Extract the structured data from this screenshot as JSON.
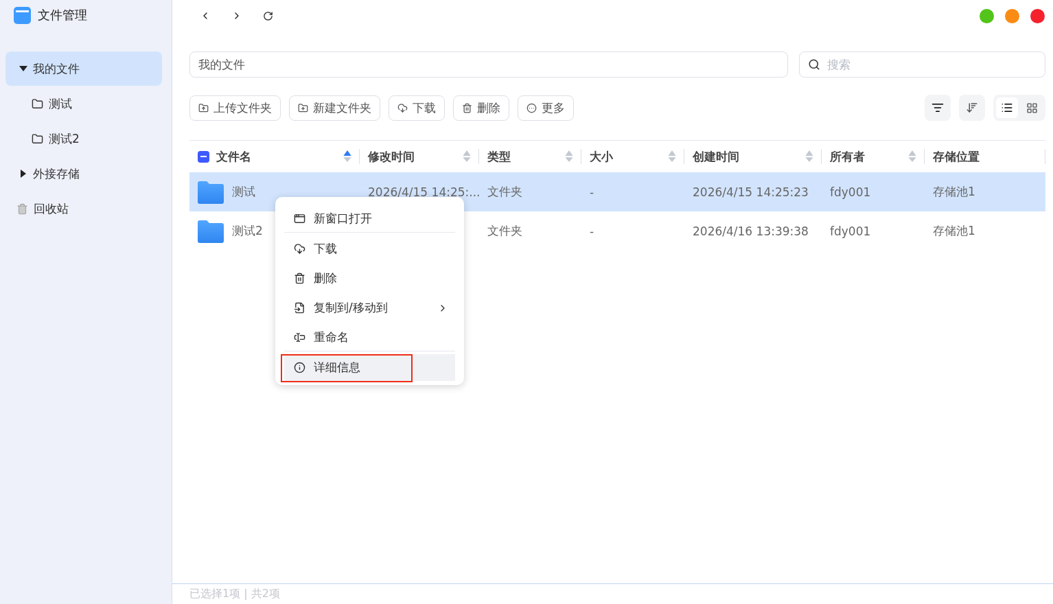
{
  "app": {
    "title": "文件管理"
  },
  "sidebar": {
    "items": [
      {
        "label": "我的文件",
        "kind": "tree",
        "expanded": true,
        "selected": true,
        "children": [
          {
            "label": "测试",
            "kind": "folder",
            "selected": false
          },
          {
            "label": "测试2",
            "kind": "folder",
            "selected": false
          }
        ]
      },
      {
        "label": "外接存储",
        "kind": "tree",
        "expanded": false,
        "selected": false
      },
      {
        "label": "回收站",
        "kind": "trash",
        "selected": false
      }
    ]
  },
  "window_controls": [
    {
      "color": "#52c41a"
    },
    {
      "color": "#fa8c16"
    },
    {
      "color": "#f5222d"
    }
  ],
  "path": {
    "value": "我的文件"
  },
  "search": {
    "placeholder": "搜索"
  },
  "toolbar": {
    "buttons": [
      "上传文件夹",
      "新建文件夹",
      "下载",
      "删除",
      "更多"
    ],
    "views": [
      {
        "selected": true
      },
      {
        "selected": false
      }
    ]
  },
  "table": {
    "partially_selected": true,
    "columns": [
      {
        "label": "文件名",
        "sortable": true,
        "sorted_ascending": true
      },
      {
        "label": "修改时间",
        "sortable": true,
        "sorted_ascending": false
      },
      {
        "label": "类型",
        "sortable": true,
        "sorted_ascending": false
      },
      {
        "label": "大小",
        "sortable": true,
        "sorted_ascending": false
      },
      {
        "label": "创建时间",
        "sortable": true,
        "sorted_ascending": false
      },
      {
        "label": "所有者",
        "sortable": true,
        "sorted_ascending": false
      },
      {
        "label": "存储位置"
      }
    ],
    "rows": [
      {
        "selected": true,
        "cells": [
          "测试",
          "2026/4/15 14:25:...",
          "文件夹",
          "-",
          "2026/4/15 14:25:23",
          "fdy001",
          "存储池1"
        ]
      },
      {
        "selected": false,
        "cells": [
          "测试2",
          "",
          "文件夹",
          "-",
          "2026/4/16 13:39:38",
          "fdy001",
          "存储池1"
        ]
      }
    ]
  },
  "context_menu": {
    "items": [
      {
        "label": "新窗口打开",
        "kind": "item",
        "divider_after": true,
        "hovered": false,
        "outlined": false
      },
      {
        "label": "下载",
        "kind": "item",
        "divider_after": false,
        "hovered": false,
        "outlined": false
      },
      {
        "label": "删除",
        "kind": "item",
        "divider_after": false,
        "hovered": false,
        "outlined": false
      },
      {
        "label": "复制到/移动到",
        "kind": "submenu",
        "divider_after": false,
        "hovered": false,
        "outlined": false
      },
      {
        "label": "重命名",
        "kind": "item",
        "divider_after": true,
        "hovered": false,
        "outlined": false
      },
      {
        "label": "详细信息",
        "kind": "item",
        "divider_after": false,
        "hovered": true,
        "outlined": true
      }
    ]
  },
  "status_bar": {
    "text": "已选择1项 | 共2项"
  }
}
